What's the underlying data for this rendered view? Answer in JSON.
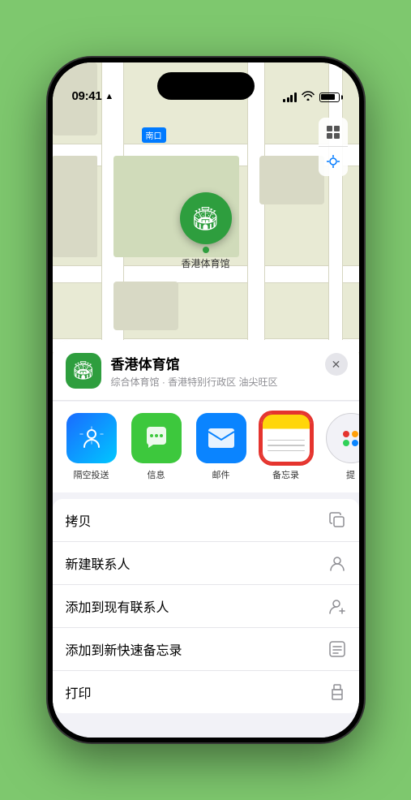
{
  "status_bar": {
    "time": "09:41",
    "location_arrow": "▶"
  },
  "map": {
    "label_tag": "南口",
    "map_icon": "🗺",
    "location_icon": "◎"
  },
  "pin": {
    "label": "香港体育馆"
  },
  "location_header": {
    "name": "香港体育馆",
    "description": "综合体育馆 · 香港特别行政区 油尖旺区",
    "close_label": "✕"
  },
  "share_items": [
    {
      "id": "airdrop",
      "label": "隔空投送",
      "type": "airdrop"
    },
    {
      "id": "messages",
      "label": "信息",
      "type": "messages"
    },
    {
      "id": "mail",
      "label": "邮件",
      "type": "mail"
    },
    {
      "id": "notes",
      "label": "备忘录",
      "type": "notes",
      "highlighted": true
    },
    {
      "id": "more",
      "label": "提",
      "type": "more"
    }
  ],
  "action_items": [
    {
      "id": "copy",
      "label": "拷贝",
      "icon": "⧉"
    },
    {
      "id": "new-contact",
      "label": "新建联系人",
      "icon": "👤"
    },
    {
      "id": "add-contact",
      "label": "添加到现有联系人",
      "icon": "👤"
    },
    {
      "id": "quick-note",
      "label": "添加到新快速备忘录",
      "icon": "⊞"
    },
    {
      "id": "print",
      "label": "打印",
      "icon": "🖨"
    }
  ]
}
